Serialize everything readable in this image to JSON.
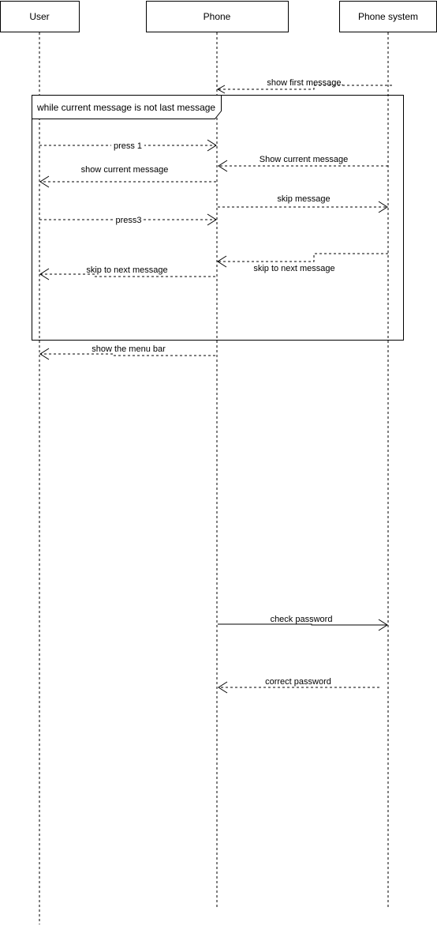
{
  "lifelines": [
    {
      "id": "user",
      "name": "User"
    },
    {
      "id": "phone",
      "name": "Phone"
    },
    {
      "id": "system",
      "name": "Phone system"
    }
  ],
  "frame": {
    "label": "while current message is not last message"
  },
  "messages": [
    {
      "id": "show-first-message",
      "label": "show first message.",
      "from": "system",
      "to": "phone",
      "style": "dashed"
    },
    {
      "id": "press-1",
      "label": "press 1",
      "from": "user",
      "to": "phone",
      "style": "dashed"
    },
    {
      "id": "show-current-message-sys",
      "label": "Show current message",
      "from": "system",
      "to": "phone",
      "style": "dashed"
    },
    {
      "id": "show-current-message-user",
      "label": "show current message",
      "from": "phone",
      "to": "user",
      "style": "dashed"
    },
    {
      "id": "skip-message",
      "label": "skip message",
      "from": "phone",
      "to": "system",
      "style": "dashed"
    },
    {
      "id": "press3",
      "label": "press3",
      "from": "user",
      "to": "phone",
      "style": "dashed"
    },
    {
      "id": "skip-to-next-sys",
      "label": "skip to next message",
      "from": "system",
      "to": "phone",
      "style": "dashed"
    },
    {
      "id": "skip-to-next-user",
      "label": "skip to next message",
      "from": "phone",
      "to": "user",
      "style": "dashed"
    },
    {
      "id": "show-menu-bar",
      "label": "show the menu bar",
      "from": "phone",
      "to": "user",
      "style": "dashed"
    },
    {
      "id": "check-password",
      "label": "check password",
      "from": "phone",
      "to": "system",
      "style": "solid"
    },
    {
      "id": "correct-password",
      "label": "correct password",
      "from": "system",
      "to": "phone",
      "style": "dashed"
    }
  ]
}
